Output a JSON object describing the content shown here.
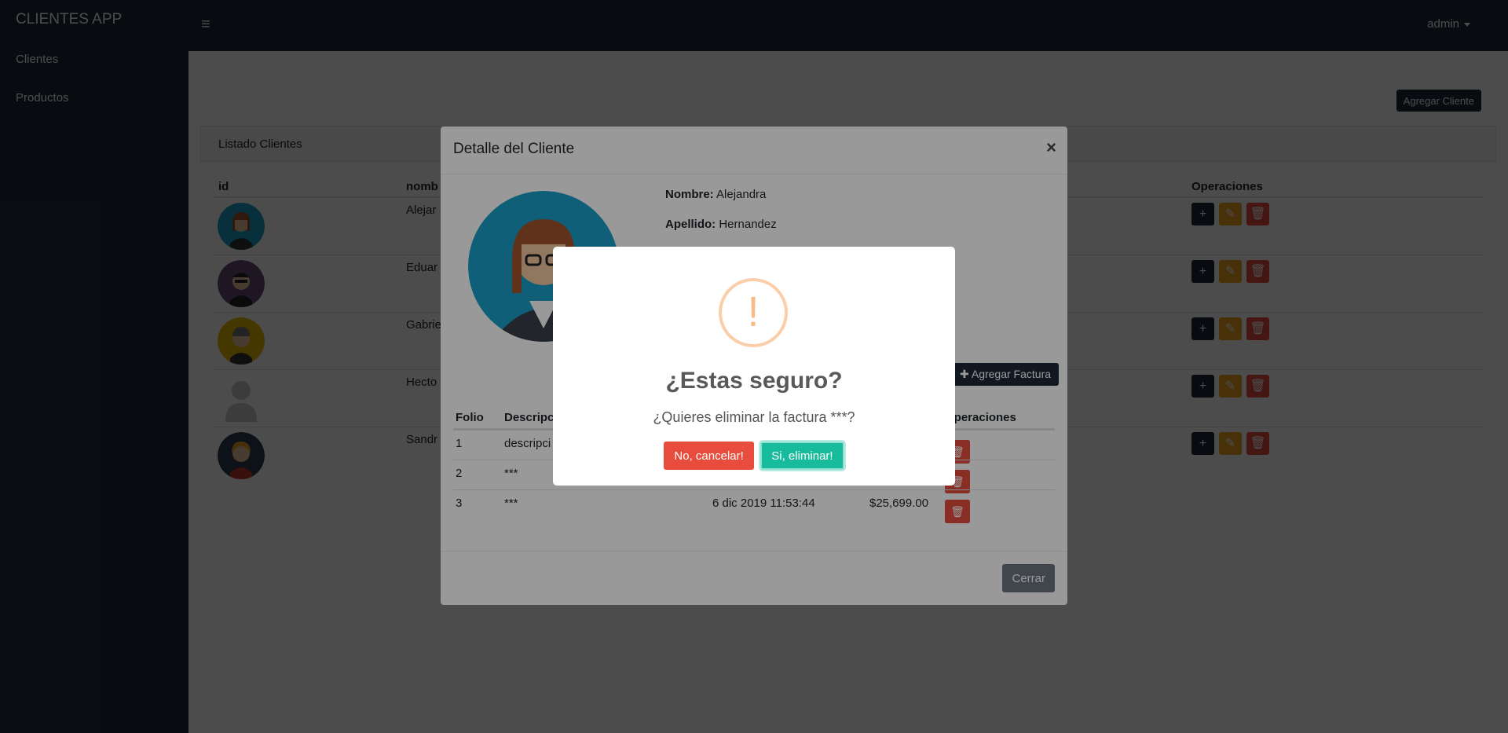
{
  "app": {
    "brand": "CLIENTES APP"
  },
  "sidebar": {
    "items": [
      {
        "label": "Clientes"
      },
      {
        "label": "Productos"
      }
    ]
  },
  "topbar": {
    "user": "admin"
  },
  "main": {
    "add_client_label": "Agregar Cliente",
    "card_title": "Listado Clientes",
    "columns": {
      "id": "id",
      "name": "nomb",
      "operations": "Operaciones"
    },
    "rows": [
      {
        "name": "Alejar"
      },
      {
        "name": "Eduar"
      },
      {
        "name": "Gabrie"
      },
      {
        "name": "Hecto"
      },
      {
        "name": "Sandr"
      }
    ]
  },
  "detail_modal": {
    "title": "Detalle del Cliente",
    "close_symbol": "×",
    "nombre_label": "Nombre:",
    "nombre_value": "Alejandra",
    "apellido_label": "Apellido:",
    "apellido_value": "Hernandez",
    "add_invoice_label": "Agregar Factura",
    "invoice_columns": {
      "folio": "Folio",
      "description": "Descripci",
      "operations": "Operaciones"
    },
    "invoices": [
      {
        "folio": "1",
        "description": "descripci",
        "date": "",
        "total": ""
      },
      {
        "folio": "2",
        "description": "***",
        "date": "",
        "total": ""
      },
      {
        "folio": "3",
        "description": "***",
        "date": "6 dic 2019 11:53:44",
        "total": "$25,699.00"
      }
    ],
    "close_button": "Cerrar"
  },
  "confirm_dialog": {
    "icon_symbol": "!",
    "title": "¿Estas seguro?",
    "text": "¿Quieres eliminar la factura ***?",
    "cancel_label": "No, cancelar!",
    "confirm_label": "Si, eliminar!"
  },
  "colors": {
    "navbar": "#1d2939",
    "warning": "#f0a020",
    "danger": "#e74c3c",
    "success": "#18bc9c",
    "secondary": "#6c757d"
  }
}
